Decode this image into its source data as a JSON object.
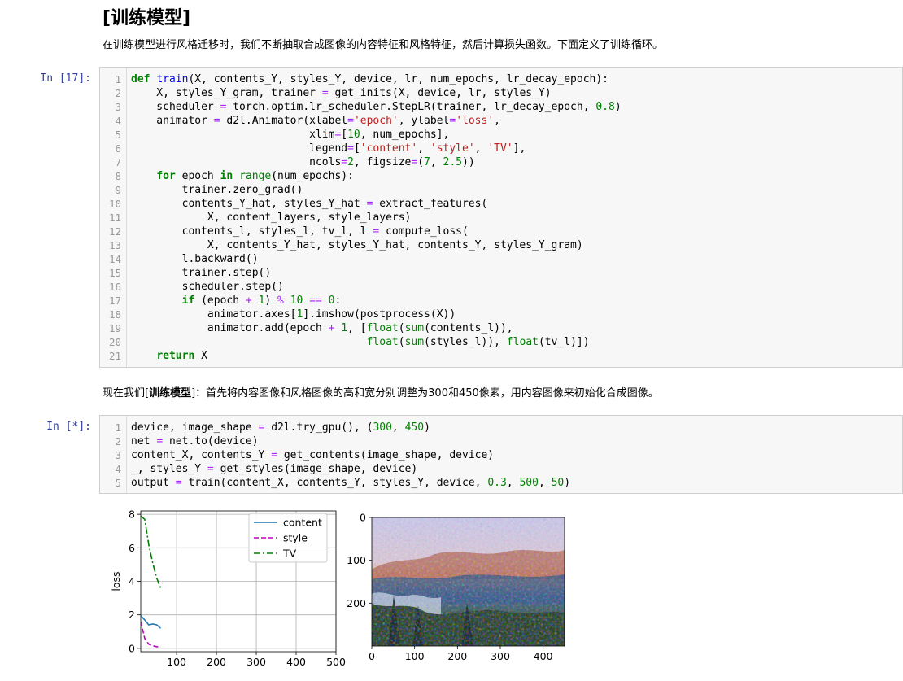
{
  "section": {
    "title": "[训练模型]",
    "intro": "在训练模型进行风格迁移时，我们不断抽取合成图像的内容特征和风格特征，然后计算损失函数。下面定义了训练循环。",
    "para2_prefix": "现在我们[",
    "para2_bold": "训练模型",
    "para2_suffix": "]：首先将内容图像和风格图像的高和宽分别调整为300和450像素，用内容图像来初始化合成图像。"
  },
  "cell1": {
    "prompt": "In [17]:",
    "line_numbers": [
      "1",
      "2",
      "3",
      "4",
      "5",
      "6",
      "7",
      "8",
      "9",
      "10",
      "11",
      "12",
      "13",
      "14",
      "15",
      "16",
      "17",
      "18",
      "19",
      "20",
      "21"
    ]
  },
  "cell2": {
    "prompt": "In [*]:",
    "line_numbers": [
      "1",
      "2",
      "3",
      "4",
      "5"
    ]
  },
  "chart_data": [
    {
      "type": "line",
      "title": "",
      "xlabel": "",
      "ylabel": "loss",
      "xlim": [
        10,
        500
      ],
      "ylim": [
        -0.2,
        8.2
      ],
      "xticks": [
        "100",
        "200",
        "300",
        "400",
        "500"
      ],
      "yticks": [
        "0",
        "2",
        "4",
        "6",
        "8"
      ],
      "grid": true,
      "legend_position": "top-right",
      "series": [
        {
          "name": "content",
          "color": "#1f77b4",
          "dash": "solid",
          "x": [
            10,
            20,
            30,
            40,
            50,
            60
          ],
          "y": [
            1.95,
            1.7,
            1.4,
            1.45,
            1.4,
            1.2
          ]
        },
        {
          "name": "style",
          "color": "#bf00bf",
          "dash": "dashed",
          "x": [
            10,
            20,
            30,
            40,
            50,
            60
          ],
          "y": [
            1.6,
            0.6,
            0.25,
            0.15,
            0.1,
            0.08
          ]
        },
        {
          "name": "TV",
          "color": "#008000",
          "dash": "dashdot",
          "x": [
            10,
            20,
            30,
            40,
            50,
            60
          ],
          "y": [
            7.9,
            7.7,
            6.2,
            5.1,
            4.2,
            3.6
          ]
        }
      ]
    },
    {
      "type": "heatmap",
      "title": "",
      "xticks": [
        "0",
        "100",
        "200",
        "300",
        "400"
      ],
      "yticks": [
        "0",
        "100",
        "200"
      ],
      "xlim": [
        0,
        450
      ],
      "ylim": [
        300,
        0
      ]
    }
  ]
}
